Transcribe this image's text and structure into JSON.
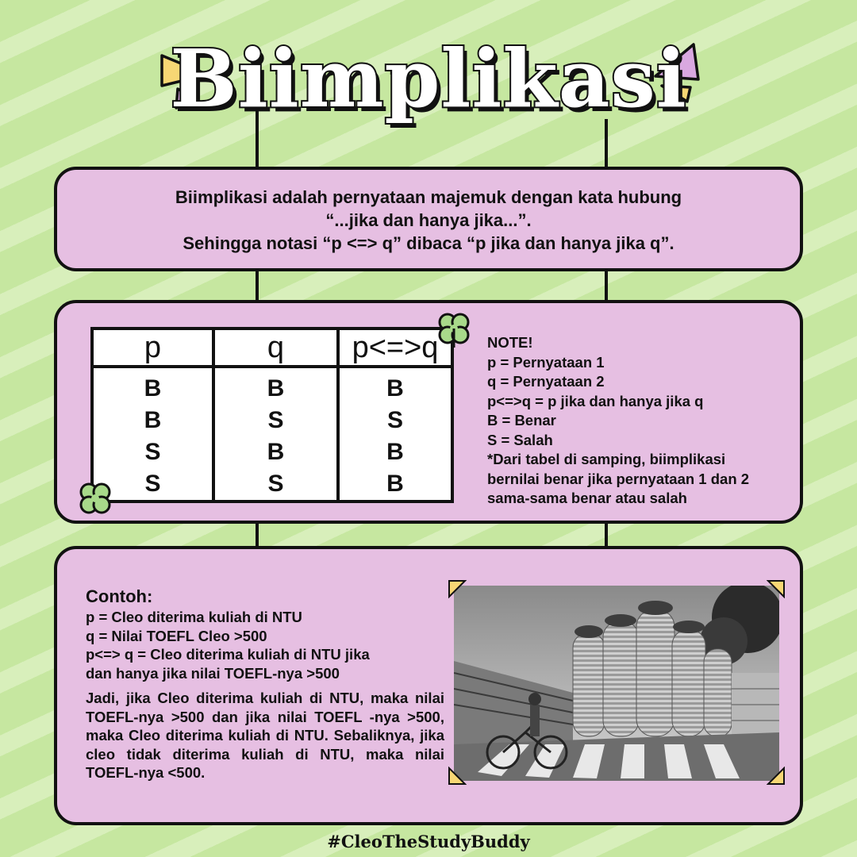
{
  "title": "Biimplikasi",
  "definition": {
    "line1": "Biimplikasi adalah pernyataan majemuk dengan kata hubung",
    "line2": "“...jika dan hanya jika...”.",
    "line3": "Sehingga notasi “p <=> q” dibaca “p jika dan hanya jika q”."
  },
  "truth_table": {
    "headers": [
      "p",
      "q",
      "p<=>q"
    ],
    "rows": [
      [
        "B",
        "B",
        "B"
      ],
      [
        "B",
        "S",
        "S"
      ],
      [
        "S",
        "B",
        "B"
      ],
      [
        "S",
        "S",
        "B"
      ]
    ]
  },
  "note": {
    "heading": "NOTE!",
    "lines": [
      "p = Pernyataan 1",
      "q = Pernyataan 2",
      "p<=>q = p jika dan hanya jika q",
      "B = Benar",
      "S = Salah",
      "*Dari tabel di samping, biimplikasi",
      "bernilai benar jika pernyataan 1 dan 2",
      "sama-sama benar atau salah"
    ]
  },
  "example": {
    "heading": "Contoh:",
    "lines": [
      "p = Cleo diterima kuliah di NTU",
      "q = Nilai TOEFL Cleo >500",
      "p<=> q = Cleo diterima kuliah di NTU jika",
      "dan hanya jika nilai TOEFL-nya >500"
    ],
    "paragraph": "Jadi, jika Cleo diterima kuliah di NTU, maka nilai TOEFL-nya >500 dan jika nilai TOEFL -nya >500, maka Cleo diterima kuliah di NTU. Sebaliknya, jika cleo tidak diterima kuliah di NTU, maka nilai TOEFL-nya <500."
  },
  "hashtag": "#CleoTheStudyBuddy",
  "colors": {
    "background": "#c6e7a0",
    "panel": "#e6bfe2",
    "yellow": "#f7d774",
    "lilac": "#d9a8e0",
    "clover": "#a8d98a"
  },
  "icons": [
    "clover-icon",
    "triangle-decoration"
  ]
}
